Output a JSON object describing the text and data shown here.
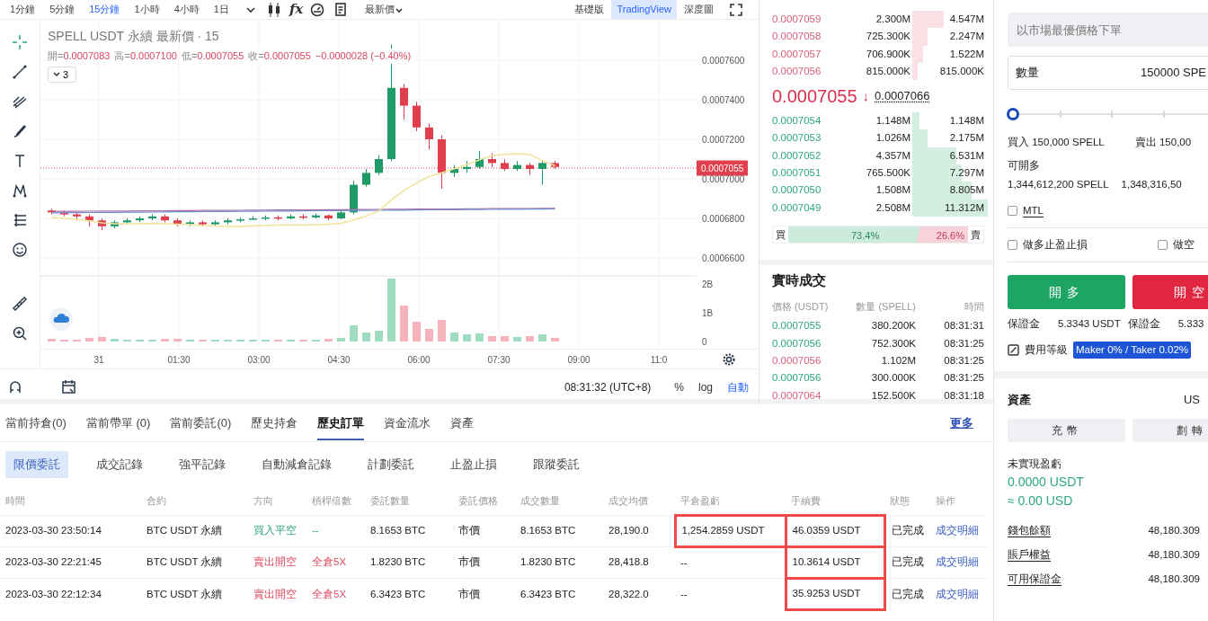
{
  "toolbar": {
    "intervals": [
      {
        "label": "1分鐘",
        "selected": false
      },
      {
        "label": "5分鐘",
        "selected": false
      },
      {
        "label": "15分鐘",
        "selected": true
      },
      {
        "label": "1小時",
        "selected": false
      },
      {
        "label": "4小時",
        "selected": false
      },
      {
        "label": "1日",
        "selected": false
      }
    ],
    "fx_symbol": "fx",
    "price_type": "最新價",
    "views": [
      {
        "label": "基礎版",
        "selected": false
      },
      {
        "label": "TradingView",
        "selected": true
      },
      {
        "label": "深度圖",
        "selected": false
      }
    ]
  },
  "chart": {
    "title": "SPELL USDT 永續 最新價 · 15",
    "ohlc": [
      {
        "label": "開=",
        "value": "0.0007083"
      },
      {
        "label": "高=",
        "value": "0.0007100"
      },
      {
        "label": "低=",
        "value": "0.0007055"
      },
      {
        "label": "收=",
        "value": "0.0007055"
      }
    ],
    "change": "−0.0000028 (−0.40%)",
    "collapse_count": "3",
    "price_ticks": [
      "0.0007600",
      "0.0007400",
      "0.0007200",
      "0.0007000",
      "0.0006800",
      "0.0006600"
    ],
    "last_price": "0.0007055",
    "volume_ticks": [
      "2B",
      "1B",
      "0"
    ],
    "time_ticks": [
      "31",
      "01:30",
      "03:00",
      "04:30",
      "06:00",
      "07:30",
      "09:00",
      "11:0"
    ],
    "clock": "08:31:32 (UTC+8)",
    "scale_options": [
      {
        "label": "%",
        "selected": false
      },
      {
        "label": "log",
        "selected": false
      },
      {
        "label": "自動",
        "selected": true
      }
    ]
  },
  "order_book": {
    "asks": [
      {
        "price": "0.0007059",
        "qty": "2.300M",
        "total": "4.547M"
      },
      {
        "price": "0.0007058",
        "qty": "725.300K",
        "total": "2.247M"
      },
      {
        "price": "0.0007057",
        "qty": "706.900K",
        "total": "1.522M"
      },
      {
        "price": "0.0007056",
        "qty": "815.000K",
        "total": "815.000K"
      }
    ],
    "mid_price": "0.0007055",
    "mid_arrow": "↓",
    "mark_price": "0.0007066",
    "bids": [
      {
        "price": "0.0007054",
        "qty": "1.148M",
        "total": "1.148M"
      },
      {
        "price": "0.0007053",
        "qty": "1.026M",
        "total": "2.175M"
      },
      {
        "price": "0.0007052",
        "qty": "4.357M",
        "total": "6.531M"
      },
      {
        "price": "0.0007051",
        "qty": "765.500K",
        "total": "7.297M"
      },
      {
        "price": "0.0007050",
        "qty": "1.508M",
        "total": "8.805M"
      },
      {
        "price": "0.0007049",
        "qty": "2.508M",
        "total": "11.312M"
      }
    ],
    "buy_label": "買",
    "buy_ratio": "73.4%",
    "sell_ratio": "26.6%",
    "sell_label": "賣",
    "level": 0.734
  },
  "trades": {
    "title": "實時成交",
    "columns": [
      "價格 (USDT)",
      "數量 (SPELL)",
      "時間"
    ],
    "rows": [
      {
        "price": "0.0007055",
        "qty": "380.200K",
        "time": "08:31:31",
        "kind": "buy"
      },
      {
        "price": "0.0007056",
        "qty": "752.300K",
        "time": "08:31:25",
        "kind": "buy"
      },
      {
        "price": "0.0007056",
        "qty": "1.102M",
        "time": "08:31:25",
        "kind": "sell"
      },
      {
        "price": "0.0007056",
        "qty": "300.000K",
        "time": "08:31:25",
        "kind": "buy"
      },
      {
        "price": "0.0007064",
        "qty": "152.500K",
        "time": "08:31:18",
        "kind": "sell"
      }
    ]
  },
  "order_form": {
    "placeholder": "以市場最優價格下單",
    "quantity_label": "數量",
    "quantity": "150000 SPE",
    "level": 0,
    "buy_amount": "買入 150,000 SPELL",
    "sell_amount": "賣出 150,00",
    "long_label": "可開多",
    "long_max": "1,344,612,200 SPELL",
    "short_max": "1,348,316,50",
    "options": [
      {
        "label": "MTL",
        "checked": false
      }
    ],
    "tpsl": [
      {
        "label": "做多止盈止損",
        "checked": false
      },
      {
        "label": "做空",
        "checked": false
      }
    ],
    "buttons": [
      {
        "label": "開多",
        "kind": "long"
      },
      {
        "label": "開空",
        "kind": "short"
      }
    ],
    "margins": [
      {
        "label": "保證金",
        "value": "5.3343 USDT"
      },
      {
        "label": "保證金",
        "value": "5.333"
      }
    ],
    "fee_label": "費用等級",
    "fee_badge": "Maker 0% / Taker 0.02%"
  },
  "assets": {
    "title": "資產",
    "currency": "US",
    "buttons": [
      "充幣",
      "劃轉"
    ],
    "unrealized_label": "未實現盈虧",
    "unrealized": "0.0000 USDT",
    "unrealized_usd": "≈ 0.00 USD",
    "rows": [
      {
        "label": "錢包餘額",
        "value": "48,180.309"
      },
      {
        "label": "賬戶權益",
        "value": "48,180.309"
      },
      {
        "label": "可用保證金",
        "value": "48,180.309"
      }
    ]
  },
  "history": {
    "tabs": [
      {
        "label": "當前持倉(0)",
        "selected": false
      },
      {
        "label": "當前帶單 (0)",
        "selected": false
      },
      {
        "label": "當前委託(0)",
        "selected": false
      },
      {
        "label": "歷史持倉",
        "selected": false
      },
      {
        "label": "歷史訂單",
        "selected": true
      },
      {
        "label": "資金流水",
        "selected": false
      },
      {
        "label": "資產",
        "selected": false
      }
    ],
    "more": "更多",
    "subtabs": [
      {
        "label": "限價委託",
        "selected": true
      },
      {
        "label": "成交記錄",
        "selected": false
      },
      {
        "label": "強平記錄",
        "selected": false
      },
      {
        "label": "自動減倉記錄",
        "selected": false
      },
      {
        "label": "計劃委託",
        "selected": false
      },
      {
        "label": "止盈止損",
        "selected": false
      },
      {
        "label": "跟蹤委託",
        "selected": false
      }
    ],
    "columns": [
      "時間",
      "合約",
      "方向",
      "槓桿倍數",
      "委託數量",
      "委託價格",
      "成交數量",
      "成交均價",
      "平倉盈虧",
      "手續費",
      "狀態",
      "操作"
    ],
    "rows": [
      {
        "kind": "buy",
        "cells": [
          {
            "text": "2023-03-30 23:50:14",
            "highlighted": false
          },
          {
            "text": "BTC USDT 永續",
            "highlighted": false
          },
          {
            "text": "買入平空",
            "highlighted": false
          },
          {
            "text": "--",
            "highlighted": false
          },
          {
            "text": "8.1653 BTC",
            "highlighted": false
          },
          {
            "text": "市價",
            "highlighted": false
          },
          {
            "text": "8.1653 BTC",
            "highlighted": false
          },
          {
            "text": "28,190.0",
            "highlighted": false
          },
          {
            "text": "1,254.2859 USDT",
            "highlighted": true
          },
          {
            "text": "46.0359 USDT",
            "highlighted": true
          },
          {
            "text": "已完成",
            "highlighted": false
          },
          {
            "text": "成交明細",
            "highlighted": false
          }
        ]
      },
      {
        "kind": "sell",
        "cells": [
          {
            "text": "2023-03-30 22:21:45",
            "highlighted": false
          },
          {
            "text": "BTC USDT 永續",
            "highlighted": false
          },
          {
            "text": "賣出開空",
            "highlighted": false
          },
          {
            "text": "全倉5X",
            "highlighted": false
          },
          {
            "text": "1.8230 BTC",
            "highlighted": false
          },
          {
            "text": "市價",
            "highlighted": false
          },
          {
            "text": "1.8230 BTC",
            "highlighted": false
          },
          {
            "text": "28,418.8",
            "highlighted": false
          },
          {
            "text": "--",
            "highlighted": false
          },
          {
            "text": "10.3614 USDT",
            "highlighted": true
          },
          {
            "text": "已完成",
            "highlighted": false
          },
          {
            "text": "成交明細",
            "highlighted": false
          }
        ]
      },
      {
        "kind": "sell",
        "cells": [
          {
            "text": "2023-03-30 22:12:34",
            "highlighted": false
          },
          {
            "text": "BTC USDT 永續",
            "highlighted": false
          },
          {
            "text": "賣出開空",
            "highlighted": false
          },
          {
            "text": "全倉5X",
            "highlighted": false
          },
          {
            "text": "6.3423 BTC",
            "highlighted": false
          },
          {
            "text": "市價",
            "highlighted": false
          },
          {
            "text": "6.3423 BTC",
            "highlighted": false
          },
          {
            "text": "28,322.0",
            "highlighted": false
          },
          {
            "text": "--",
            "highlighted": false
          },
          {
            "text": "35.9253 USDT",
            "highlighted": true
          },
          {
            "text": "已完成",
            "highlighted": false
          },
          {
            "text": "成交明細",
            "highlighted": false
          }
        ]
      }
    ]
  }
}
